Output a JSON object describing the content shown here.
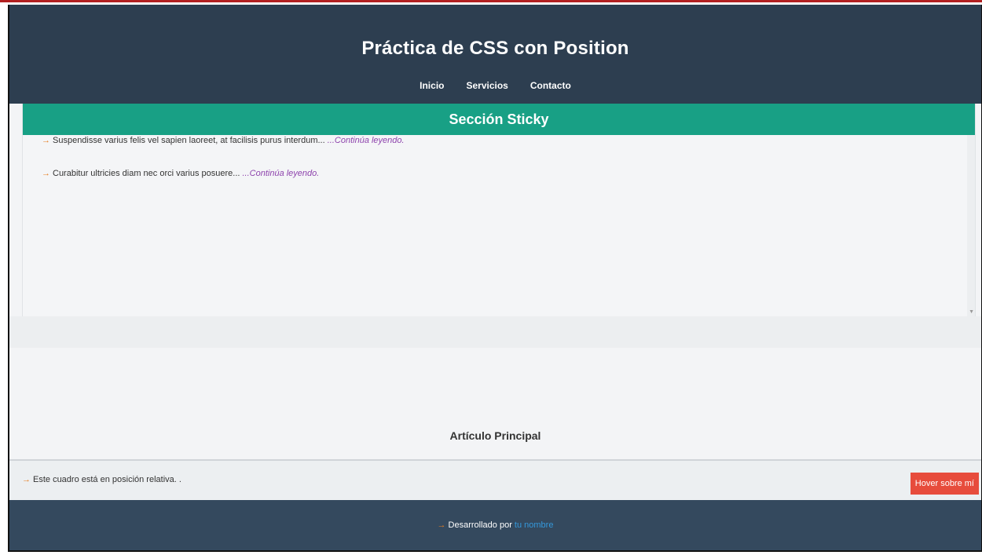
{
  "header": {
    "title": "Práctica de CSS con Position",
    "nav": [
      "Inicio",
      "Servicios",
      "Contacto"
    ]
  },
  "sticky_section": {
    "title": "Sección Sticky",
    "items": [
      {
        "arrow": "→",
        "text": "Suspendisse varius felis vel sapien laoreet, at facilisis purus interdum... ",
        "more": "...Continúa leyendo."
      },
      {
        "arrow": "→",
        "text": "Curabitur ultricies diam nec orci varius posuere... ",
        "more": "...Continúa leyendo."
      }
    ]
  },
  "article": {
    "title": "Artículo Principal"
  },
  "relative_box": {
    "arrow": "→",
    "text": "Este cuadro está en posición relativa. .",
    "button": "Hover sobre mí"
  },
  "footer": {
    "arrow": "→",
    "text": "Desarrollado por ",
    "link": "tu nombre"
  },
  "colors": {
    "header_bg": "#2d3e50",
    "sticky_bg": "#18a085",
    "accent_arrow": "#e67e22",
    "link_purple": "#8e44ad",
    "button_red": "#e74c3c",
    "footer_bg": "#34495e",
    "footer_link": "#3498db"
  }
}
